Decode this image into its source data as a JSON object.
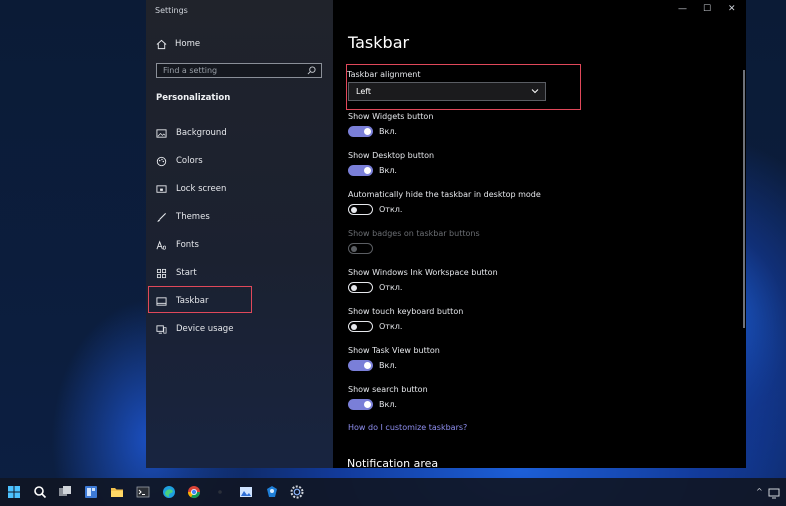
{
  "window": {
    "title": "Settings",
    "controls": {
      "minimize": "—",
      "maximize": "☐",
      "close": "✕"
    }
  },
  "sidebar": {
    "home_label": "Home",
    "search_placeholder": "Find a setting",
    "section_title": "Personalization",
    "items": [
      {
        "label": "Background",
        "icon": "image-icon"
      },
      {
        "label": "Colors",
        "icon": "palette-icon"
      },
      {
        "label": "Lock screen",
        "icon": "lock-screen-icon"
      },
      {
        "label": "Themes",
        "icon": "brush-icon"
      },
      {
        "label": "Fonts",
        "icon": "font-icon"
      },
      {
        "label": "Start",
        "icon": "start-grid-icon"
      },
      {
        "label": "Taskbar",
        "icon": "taskbar-icon",
        "selected": true
      },
      {
        "label": "Device usage",
        "icon": "device-usage-icon"
      }
    ]
  },
  "content": {
    "page_title": "Taskbar",
    "alignment": {
      "label": "Taskbar alignment",
      "value": "Left"
    },
    "settings": [
      {
        "label": "Show Widgets button",
        "state": "Вкл.",
        "on": true,
        "enabled": true
      },
      {
        "label": "Show Desktop button",
        "state": "Вкл.",
        "on": true,
        "enabled": true
      },
      {
        "label": "Automatically hide the taskbar in desktop mode",
        "state": "Откл.",
        "on": false,
        "enabled": true
      },
      {
        "label": "Show badges on taskbar buttons",
        "state": "",
        "on": false,
        "enabled": false
      },
      {
        "label": "Show Windows Ink Workspace button",
        "state": "Откл.",
        "on": false,
        "enabled": true
      },
      {
        "label": "Show touch keyboard button",
        "state": "Откл.",
        "on": false,
        "enabled": true
      },
      {
        "label": "Show Task View button",
        "state": "Вкл.",
        "on": true,
        "enabled": true
      },
      {
        "label": "Show search button",
        "state": "Вкл.",
        "on": true,
        "enabled": true
      }
    ],
    "help_link": "How do I customize taskbars?",
    "next_section": "Notification area"
  },
  "colors": {
    "highlight": "#e0485a",
    "toggle_on": "#7a7fd8",
    "link": "#8f8ff0"
  },
  "taskbar": {
    "icons": [
      "start-icon",
      "search-icon",
      "task-view-icon",
      "widgets-icon",
      "file-explorer-icon",
      "terminal-icon",
      "edge-icon",
      "chrome-icon",
      "app-icon",
      "photos-icon",
      "teams-icon",
      "settings-icon"
    ],
    "tray_chevron": "^"
  }
}
